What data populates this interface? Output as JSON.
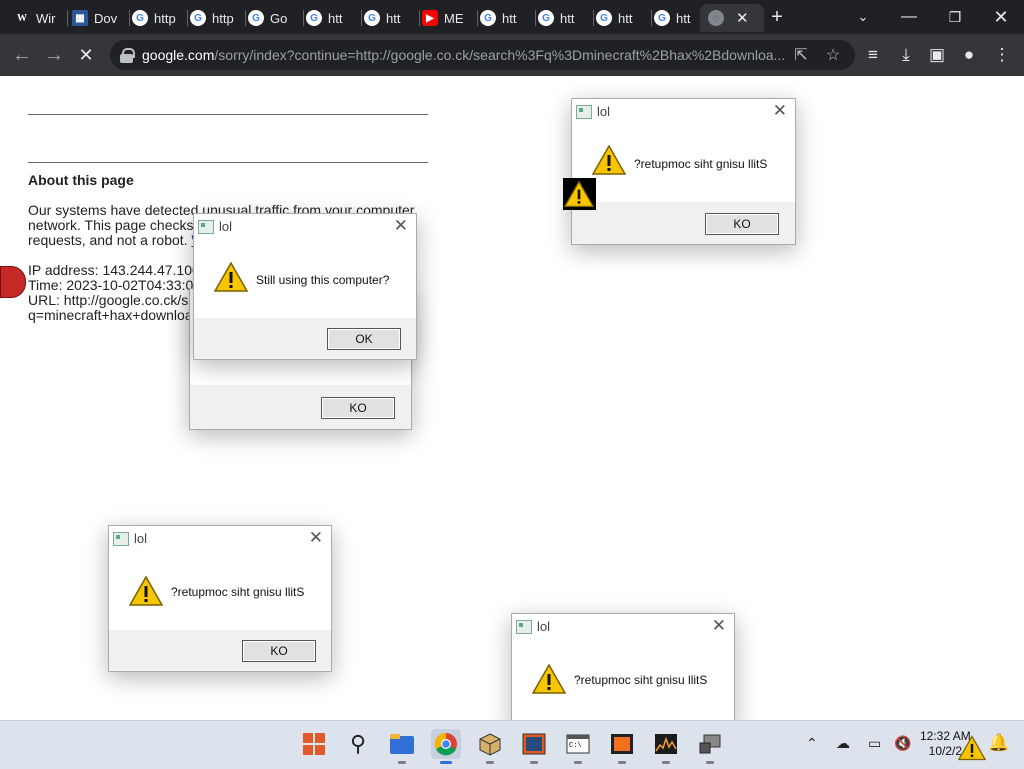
{
  "tabs": [
    {
      "label": "Wir",
      "icon": "wikipedia-icon"
    },
    {
      "label": "Dov",
      "icon": "document-icon"
    },
    {
      "label": "http",
      "icon": "google-icon"
    },
    {
      "label": "http",
      "icon": "google-icon"
    },
    {
      "label": "Go",
      "icon": "google-icon"
    },
    {
      "label": "htt",
      "icon": "google-icon"
    },
    {
      "label": "htt",
      "icon": "google-icon"
    },
    {
      "label": "ME",
      "icon": "youtube-icon"
    },
    {
      "label": "htt",
      "icon": "google-icon"
    },
    {
      "label": "htt",
      "icon": "google-icon"
    },
    {
      "label": "htt",
      "icon": "google-icon"
    },
    {
      "label": "htt",
      "icon": "google-icon"
    },
    {
      "label": "",
      "icon": "loading-icon",
      "active": true
    }
  ],
  "address": {
    "domain": "google.com",
    "path": "/sorry/index?continue=http://google.co.ck/search%3Fq%3Dminecraft%2Bhax%2Bdownloa..."
  },
  "page": {
    "about_title": "About this page",
    "para1_line1": "Our systems have detected unusual traffic from your computer",
    "para1_line2": "network. This page checks to",
    "para1_line3": "requests, and not a robot. ",
    "para1_link": "Wh",
    "ip_line": "IP address: 143.244.47.100",
    "time_line": "Time: 2023-10-02T04:33:01",
    "url_line": "URL: http://google.co.ck/sea",
    "url_line2": "q=minecraft+hax+download"
  },
  "dialogs": [
    {
      "title": "lol",
      "message": "?retupmoc siht gnisu llitS",
      "button": "KO"
    },
    {
      "title": "lol",
      "message": "",
      "button": "KO"
    },
    {
      "title": "lol",
      "message": "Still using this computer?",
      "button": "OK"
    },
    {
      "title": "lol",
      "message": "?retupmoc siht gnisu llitS",
      "button": "KO"
    },
    {
      "title": "lol",
      "message": "?retupmoc siht gnisu llitS",
      "button": ""
    }
  ],
  "clock": {
    "time": "12:32 AM",
    "date": "10/2/2"
  },
  "colors": {
    "tabstrip": "#202124",
    "toolbar": "#35363a",
    "taskbar": "#dde3ec",
    "link": "#1a0dab"
  }
}
